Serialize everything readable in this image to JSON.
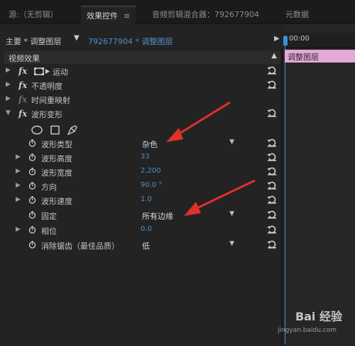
{
  "tabs": [
    {
      "label": "源:（无剪辑）"
    },
    {
      "label": "效果控件"
    },
    {
      "label": "音频剪辑混合器：792677904"
    },
    {
      "label": "元数据"
    }
  ],
  "tab_menu": "≡",
  "source_row": {
    "master": "主要 * 调整图层",
    "clip": "792677904 * 调整图层"
  },
  "section": {
    "title": "视频效果"
  },
  "effects": [
    {
      "label": "运动"
    },
    {
      "label": "不透明度"
    },
    {
      "label": "时间重映射"
    },
    {
      "label": "波形变形"
    }
  ],
  "fx_label": "fx",
  "params": [
    {
      "label": "波形类型",
      "value": "杂色"
    },
    {
      "label": "波形高度",
      "value": "33"
    },
    {
      "label": "波形宽度",
      "value": "2,200"
    },
    {
      "label": "方向",
      "value": "90.0 °"
    },
    {
      "label": "波形速度",
      "value": "1.0"
    },
    {
      "label": "固定",
      "value": "所有边缘"
    },
    {
      "label": "相位",
      "value": "0.0"
    },
    {
      "label": "消除锯齿（最佳品质）",
      "value": "低"
    }
  ],
  "timeline": {
    "timecode": "00:00",
    "clip_label": "调整图层"
  },
  "watermark": {
    "brand": "Bai 经验",
    "url": "jingyan.baidu.com"
  },
  "colors": {
    "accent": "#4f8fc6",
    "clip": "#e5a8d8",
    "arrow": "#e0302a"
  }
}
